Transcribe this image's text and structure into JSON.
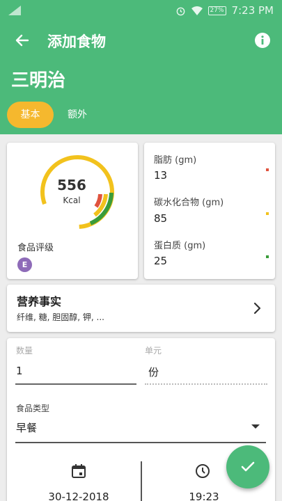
{
  "status_bar": {
    "time": "7:23 PM",
    "battery": "27%"
  },
  "app_bar": {
    "title": "添加食物"
  },
  "food": {
    "name": "三明治"
  },
  "tabs": [
    {
      "label": "基本",
      "active": true
    },
    {
      "label": "额外",
      "active": false
    }
  ],
  "calories": {
    "value": "556",
    "unit": "Kcal"
  },
  "rating": {
    "label": "食品评级",
    "grade": "E"
  },
  "macros": [
    {
      "label": "脂肪 (gm)",
      "value": "13",
      "color": "#e0533e"
    },
    {
      "label": "碳水化合物 (gm)",
      "value": "85",
      "color": "#f2c21d"
    },
    {
      "label": "蛋白质 (gm)",
      "value": "25",
      "color": "#3a9c3a"
    }
  ],
  "nutrition_facts": {
    "title": "营养事实",
    "subtitle": "纤维, 糖, 胆固醇, 钾, ..."
  },
  "form": {
    "quantity_label": "数量",
    "quantity_value": "1",
    "unit_label": "单元",
    "unit_value": "份",
    "type_label": "食品类型",
    "type_value": "早餐",
    "date": "30-12-2018",
    "time": "19:23"
  },
  "colors": {
    "primary": "#4cba7a",
    "accent": "#f5b82e",
    "grade": "#8e6bb8"
  }
}
